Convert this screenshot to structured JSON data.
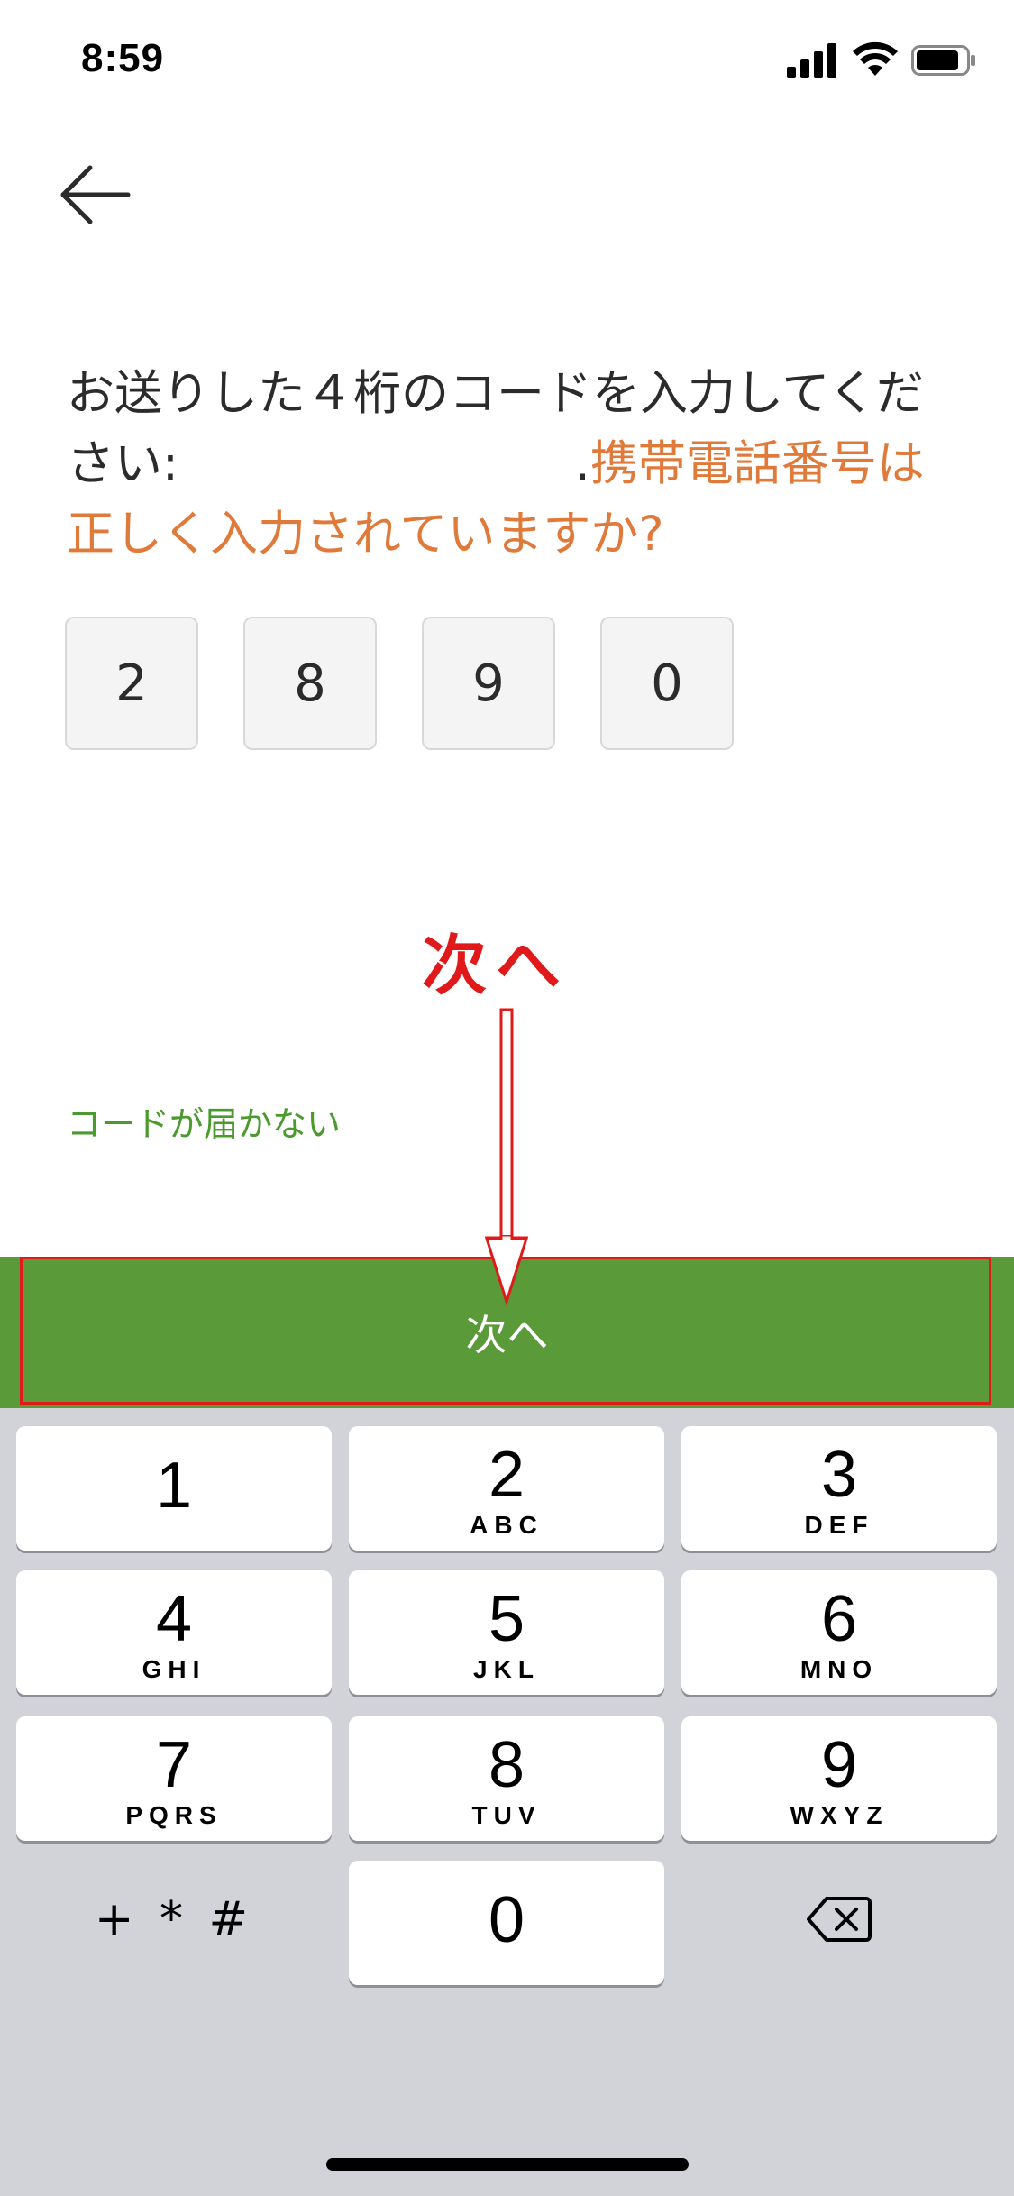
{
  "status_bar": {
    "time": "8:59"
  },
  "prompt": {
    "text_before": "お送りした４桁のコードを入力してください:",
    "text_after": ".",
    "highlight": "携帯電話番号は正しく入力されていますか?"
  },
  "code_digits": [
    "2",
    "8",
    "9",
    "0"
  ],
  "annotation": {
    "label": "次へ"
  },
  "resend_link": "コードが届かない",
  "next_button": {
    "label": "次へ"
  },
  "colors": {
    "accent_orange": "#e07a3a",
    "primary_green": "#5a9a39",
    "link_green": "#4a9a2e",
    "annotation_red": "#e01a1a"
  },
  "keypad": {
    "keys": [
      {
        "digit": "1",
        "letters": ""
      },
      {
        "digit": "2",
        "letters": "ABC"
      },
      {
        "digit": "3",
        "letters": "DEF"
      },
      {
        "digit": "4",
        "letters": "GHI"
      },
      {
        "digit": "5",
        "letters": "JKL"
      },
      {
        "digit": "6",
        "letters": "MNO"
      },
      {
        "digit": "7",
        "letters": "PQRS"
      },
      {
        "digit": "8",
        "letters": "TUV"
      },
      {
        "digit": "9",
        "letters": "WXYZ"
      },
      {
        "digit": "0",
        "letters": ""
      }
    ],
    "symbols_label": "+ * #",
    "delete_icon": "backspace-icon"
  }
}
